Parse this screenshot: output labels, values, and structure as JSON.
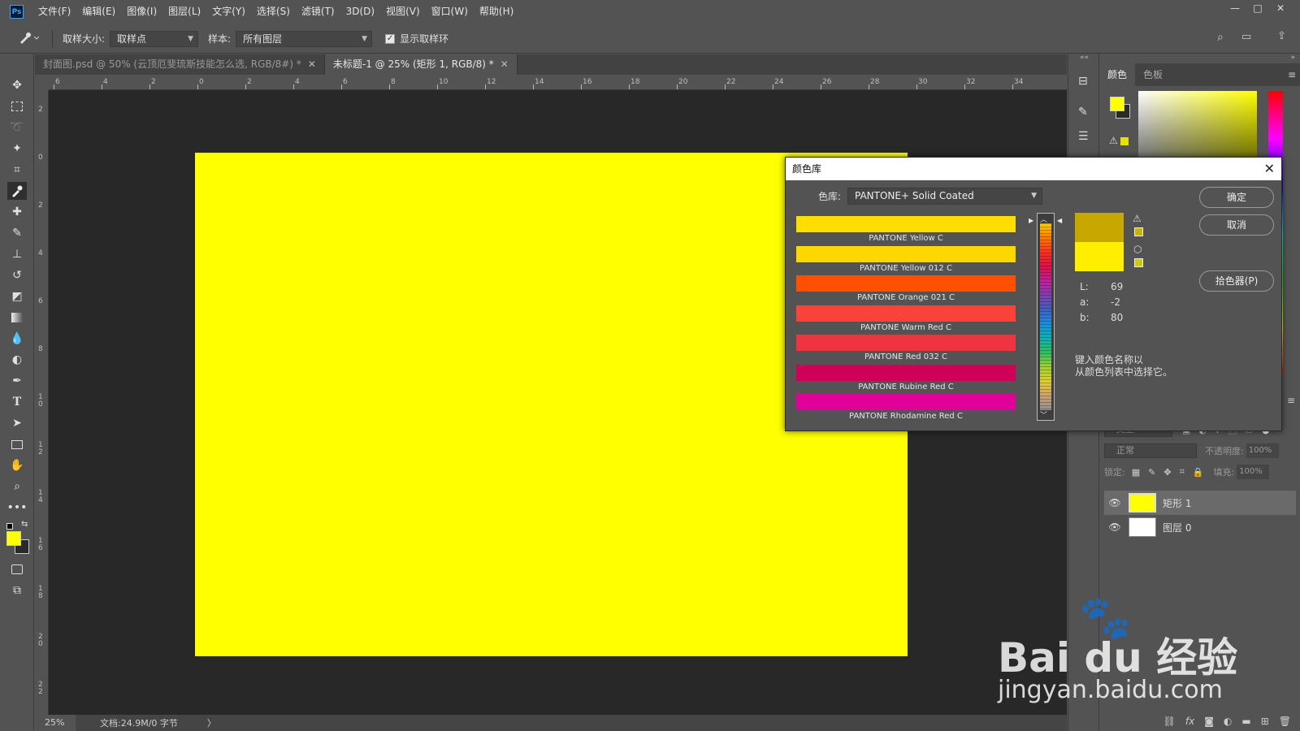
{
  "app": {
    "logo": "Ps"
  },
  "menu": [
    "文件(F)",
    "编辑(E)",
    "图像(I)",
    "图层(L)",
    "文字(Y)",
    "选择(S)",
    "滤镜(T)",
    "3D(D)",
    "视图(V)",
    "窗口(W)",
    "帮助(H)"
  ],
  "window_controls": {
    "minimize": "—",
    "maximize": "□",
    "close": "✕"
  },
  "options": {
    "sample_size_label": "取样大小:",
    "sample_size_value": "取样点",
    "sample_label": "样本:",
    "sample_value": "所有图层",
    "show_ring_label": "显示取样环",
    "show_ring_checked": true
  },
  "tabs": [
    {
      "label": "封面图.psd @ 50% (云顶厄斐琉斯技能怎么选, RGB/8#) *",
      "active": false
    },
    {
      "label": "未标题-1 @ 25% (矩形 1, RGB/8) *",
      "active": true
    }
  ],
  "ruler_h": [
    "6",
    "4",
    "2",
    "0",
    "2",
    "4",
    "6",
    "8",
    "10",
    "12",
    "14",
    "16",
    "18",
    "20",
    "22",
    "24",
    "26",
    "28",
    "30",
    "32",
    "34"
  ],
  "ruler_v": [
    "2",
    "0",
    "2",
    "4",
    "6",
    "8",
    "1 0",
    "1 2",
    "1 4",
    "1 6",
    "1 8",
    "2 0",
    "2 2"
  ],
  "status": {
    "zoom": "25%",
    "doc": "文档:24.9M/0 字节",
    "arrow": "〉"
  },
  "color_panel": {
    "tabs": [
      "颜色",
      "色板"
    ],
    "foreground": "#ffff00",
    "background": "#2a2a2a"
  },
  "layers_panel": {
    "filter_label": "类型",
    "blend_mode": "正常",
    "opacity_label": "不透明度:",
    "opacity_value": "100%",
    "lock_label": "锁定:",
    "fill_label": "填充:",
    "fill_value": "100%",
    "layers": [
      {
        "name": "矩形 1",
        "thumb": "#ffff00",
        "selected": true
      },
      {
        "name": "图层 0",
        "thumb": "#ffffff",
        "selected": false
      }
    ]
  },
  "dialog": {
    "title": "颜色库",
    "close": "✕",
    "library_label": "色库:",
    "library_value": "PANTONE+ Solid Coated",
    "swatches": [
      {
        "name": "PANTONE Yellow C",
        "color": "#fedd00"
      },
      {
        "name": "PANTONE Yellow 012 C",
        "color": "#ffd700"
      },
      {
        "name": "PANTONE Orange 021 C",
        "color": "#fe5000"
      },
      {
        "name": "PANTONE Warm Red C",
        "color": "#f9423a"
      },
      {
        "name": "PANTONE Red 032 C",
        "color": "#ef3340"
      },
      {
        "name": "PANTONE Rubine Red C",
        "color": "#ce0058"
      },
      {
        "name": "PANTONE Rhodamine Red C",
        "color": "#e10098"
      }
    ],
    "preview_new": "#c8a800",
    "preview_current": "#ffee00",
    "lab": [
      {
        "label": "L:",
        "value": "69"
      },
      {
        "label": "a:",
        "value": "-2"
      },
      {
        "label": "b:",
        "value": "80"
      }
    ],
    "hint_line1": "键入颜色名称以",
    "hint_line2": "从颜色列表中选择它。",
    "buttons": {
      "ok": "确定",
      "cancel": "取消",
      "picker": "拾色器(P)"
    }
  },
  "watermark": {
    "brand": "Bai du 经验",
    "url": "jingyan.baidu.com"
  }
}
